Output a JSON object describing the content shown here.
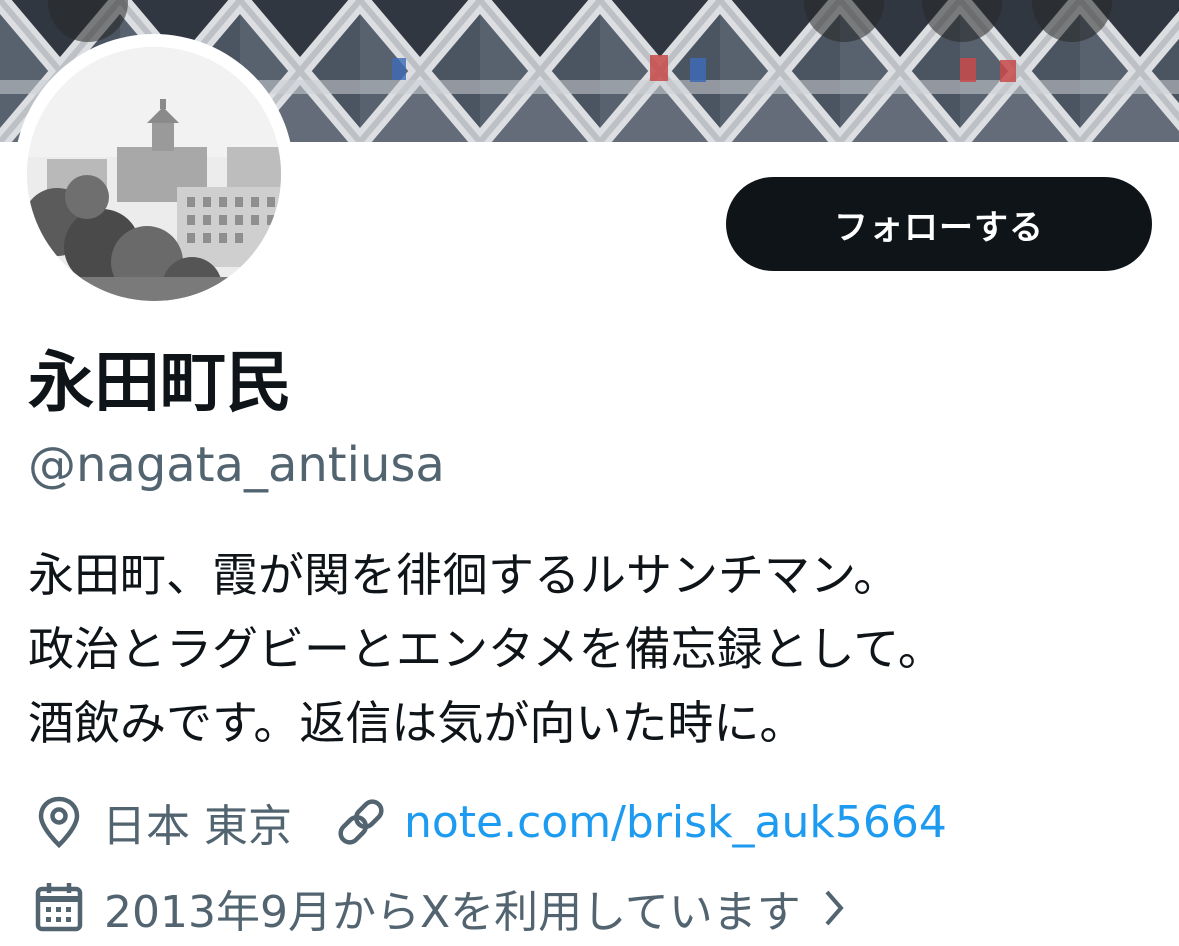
{
  "profile": {
    "display_name": "永田町民",
    "handle": "@nagata_antiusa",
    "follow_label": "フォローする",
    "bio_lines": [
      "永田町、霞が関を徘徊するルサンチマン。",
      "政治とラグビーとエンタメを備忘録として。",
      "酒飲みです。返信は気が向いた時に。"
    ],
    "location": "日本 東京",
    "website": "note.com/brisk_auk5664",
    "joined": "2013年9月からXを利用しています"
  },
  "icons": {
    "back": "back-arrow-icon",
    "refresh": "refresh-icon",
    "search": "search-icon",
    "more": "more-icon",
    "location": "location-pin-icon",
    "link": "link-icon",
    "calendar": "calendar-icon",
    "chevron": "chevron-right-icon"
  },
  "colors": {
    "text_primary": "#0f1419",
    "text_secondary": "#536471",
    "link": "#1d9bf0",
    "follow_bg": "#0f1419",
    "follow_text": "#ffffff"
  }
}
